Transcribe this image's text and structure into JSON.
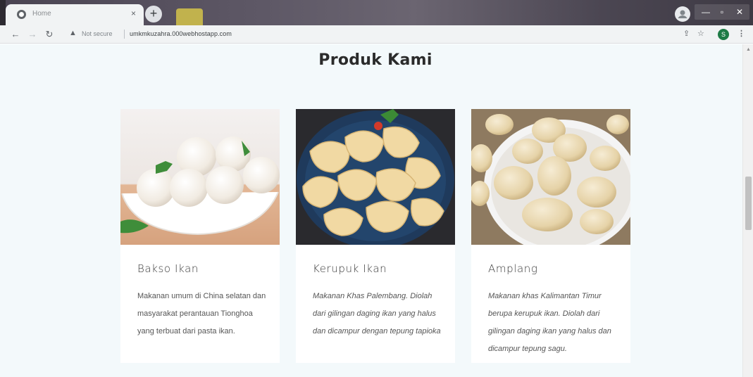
{
  "browser": {
    "tab_title": "Home",
    "tab_close": "×",
    "new_tab": "+",
    "security_label": "Not secure",
    "url": "umkmkuzahra.000webhostapp.com",
    "profile_initial": "S",
    "win_minimize": "—",
    "win_restore": "▫",
    "win_close": "✕"
  },
  "page": {
    "section_title": "Produk Kami",
    "products": [
      {
        "name": "Bakso Ikan",
        "description": "Makanan umum di China selatan dan masyarakat perantauan Tionghoa yang terbuat dari pasta ikan.",
        "italic": false
      },
      {
        "name": "Kerupuk Ikan",
        "description": "Makanan Khas Palembang. Diolah dari gilingan daging ikan yang halus dan dicampur dengan tepung tapioka",
        "italic": true
      },
      {
        "name": "Amplang",
        "description": "Makanan khas Kalimantan Timur berupa kerupuk ikan. Diolah dari gilingan daging ikan yang halus dan dicampur tepung sagu.",
        "italic": true
      }
    ]
  },
  "colors": {
    "page_background": "#f3f9fb",
    "card_background": "#ffffff",
    "title_text": "#2b2b2b",
    "body_text": "#555555",
    "avatar": "#1e7b46"
  },
  "icons": [
    "globe-icon",
    "back-arrow-icon",
    "forward-arrow-icon",
    "reload-icon",
    "warning-icon",
    "share-icon",
    "star-icon",
    "menu-dots-icon"
  ]
}
